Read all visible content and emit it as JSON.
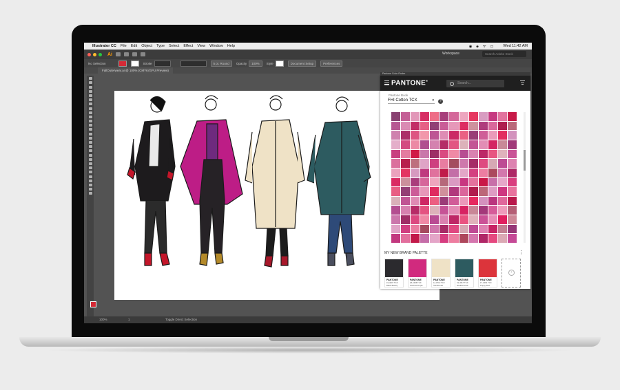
{
  "menubar": {
    "app_name": "Illustrator CC",
    "items": [
      "File",
      "Edit",
      "Object",
      "Type",
      "Select",
      "Effect",
      "View",
      "Window",
      "Help"
    ],
    "clock": "Wed 11:42 AM"
  },
  "titlebar": {
    "app_icon_text": "Ai",
    "workspace_label": "Workspace",
    "stock_search_placeholder": "Search Adobe Stock"
  },
  "controlbar": {
    "selection": "No Selection",
    "stroke_label": "Stroke",
    "brush": "5 pt. Round",
    "opacity_label": "Opacity",
    "opacity_value": "100%",
    "style_label": "Style",
    "doc_setup": "Document Setup",
    "preferences": "Preferences"
  },
  "document": {
    "tab_title": "FallOuterwear.ai @ 100% (CMYK/GPU Preview)"
  },
  "statusbar": {
    "zoom": "100%",
    "artboard": "1",
    "status_text": "Toggle Direct Selection"
  },
  "panel": {
    "window_title": "Pantone Color Finder",
    "brand": "PANTONE",
    "search_placeholder": "Search...",
    "book_label": "Pantone Book",
    "book_value": "FHI Cotton TCX",
    "palette_title": "MY NEW BRAND PALETTE",
    "palette": [
      {
        "label": "PANTONE",
        "code": "19-4007 TCX",
        "name": "Black Beauty",
        "color": "#2b2a2e"
      },
      {
        "label": "PANTONE",
        "code": "18-2436 TCX",
        "name": "Fuchsia Purple",
        "color": "#d12a7e"
      },
      {
        "label": "PANTONE",
        "code": "12-0710 TCX",
        "name": "Shortbread",
        "color": "#efe2c6"
      },
      {
        "label": "PANTONE",
        "code": "19-4517 TCX",
        "name": "Mediterranea",
        "color": "#2d5b60"
      },
      {
        "label": "PANTONE",
        "code": "17-1664 TCX",
        "name": "Poppy Red",
        "color": "#dc343b"
      }
    ]
  },
  "colors": {
    "accent": "#d42a36",
    "panel_header": "#1f1f1f",
    "ui_dark": "#535353"
  },
  "icons": [
    "apple-icon",
    "search-icon",
    "hamburger-icon",
    "filter-icon",
    "help-icon",
    "add-icon",
    "chevron-down-icon"
  ]
}
